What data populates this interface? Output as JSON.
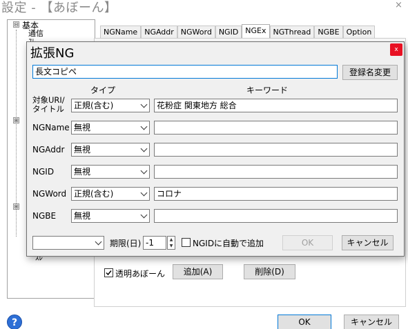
{
  "window": {
    "title": "設定 - 【あぼーん】",
    "close_glyph": "×"
  },
  "tree": {
    "root_label": "基本",
    "child_1": "通信",
    "child_2": "ｽﾚ",
    "expand_glyph": "⊟",
    "collapsed_glyph": "⊞",
    "frag_3": "ｽﾚ"
  },
  "tabs": [
    "NGName",
    "NGAddr",
    "NGWord",
    "NGID",
    "NGEx",
    "NGThread",
    "NGBE",
    "Option"
  ],
  "tab_panel": {
    "hidden_header": "",
    "transparent_label": "透明あぼーん",
    "transparent_checked": true,
    "add_button": "追加(A)",
    "delete_button": "削除(D)"
  },
  "footer": {
    "ok": "OK",
    "cancel": "キャンセル",
    "help_glyph": "?"
  },
  "dialog": {
    "title": "拡張NG",
    "close_glyph": "x",
    "name_value": "長文コピペ",
    "rename_button": "登録名変更",
    "col_type": "タイプ",
    "col_keyword": "キーワード",
    "rows": [
      {
        "label": "対象URI/\nタイトル",
        "label_line1": "対象URI/",
        "label_line2": "タイトル",
        "type": "正規(含む)",
        "keyword": "花粉症 関東地方 総合"
      },
      {
        "label": "NGName",
        "type": "無視",
        "keyword": ""
      },
      {
        "label": "NGAddr",
        "type": "無視",
        "keyword": ""
      },
      {
        "label": "NGID",
        "type": "無視",
        "keyword": ""
      },
      {
        "label": "NGWord",
        "type": "正規(含む)",
        "keyword": "コロナ"
      },
      {
        "label": "NGBE",
        "type": "無視",
        "keyword": ""
      }
    ],
    "bottom_select_value": "",
    "period_label": "期限(日)",
    "period_value": "-1",
    "auto_ngid_label": "NGIDに自動で追加",
    "auto_ngid_checked": false,
    "ok_button": "OK",
    "cancel_button": "キャンセル"
  }
}
